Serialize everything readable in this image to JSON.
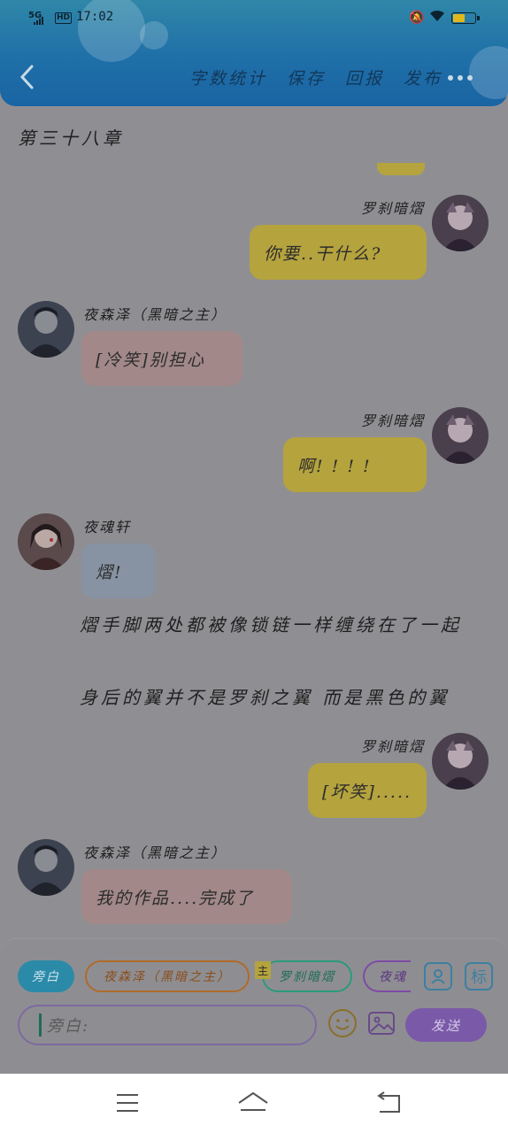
{
  "status_bar": {
    "network": "5G",
    "hd": "HD",
    "time": "17:02",
    "battery_level": 0.55
  },
  "nav": {
    "actions": [
      "字数统计",
      "保存",
      "回报",
      "发布"
    ]
  },
  "chapter_title": "第三十八章",
  "messages": [
    {
      "sender": "罗刹暗熠",
      "text": "你要..干什么?"
    },
    {
      "sender": "夜森泽（黑暗之主）",
      "text": "[冷笑]别担心"
    },
    {
      "sender": "罗刹暗熠",
      "text": "啊! ! ! !"
    },
    {
      "sender": "夜魂轩",
      "text": "熠!"
    },
    {
      "sender": "罗刹暗熠",
      "text": "[坏笑]....."
    },
    {
      "sender": "夜森泽（黑暗之主）",
      "text": "我的作品....完成了"
    }
  ],
  "narration": [
    "熠手脚两处都被像锁链一样缠绕在了一起",
    "身后的翼并不是罗刹之翼 而是黑色的翼"
  ],
  "compose": {
    "chips": [
      "旁白",
      "夜森泽（黑暗之主）",
      "罗刹暗熠",
      "夜魂"
    ],
    "master_badge": "主",
    "tag_label": "标",
    "input_placeholder": "旁白:",
    "send_label": "发送"
  },
  "colors": {
    "header": "#1f6fa8",
    "bubble_self": "#b5a33e",
    "bubble_master": "#a28888",
    "bubble_other": "#8792a2",
    "send": "#7a5aa8"
  },
  "icons": [
    "back-icon",
    "more-icon",
    "character-icon",
    "tag-icon",
    "emoji-icon",
    "image-icon",
    "menu-icon",
    "home-icon",
    "return-icon"
  ]
}
